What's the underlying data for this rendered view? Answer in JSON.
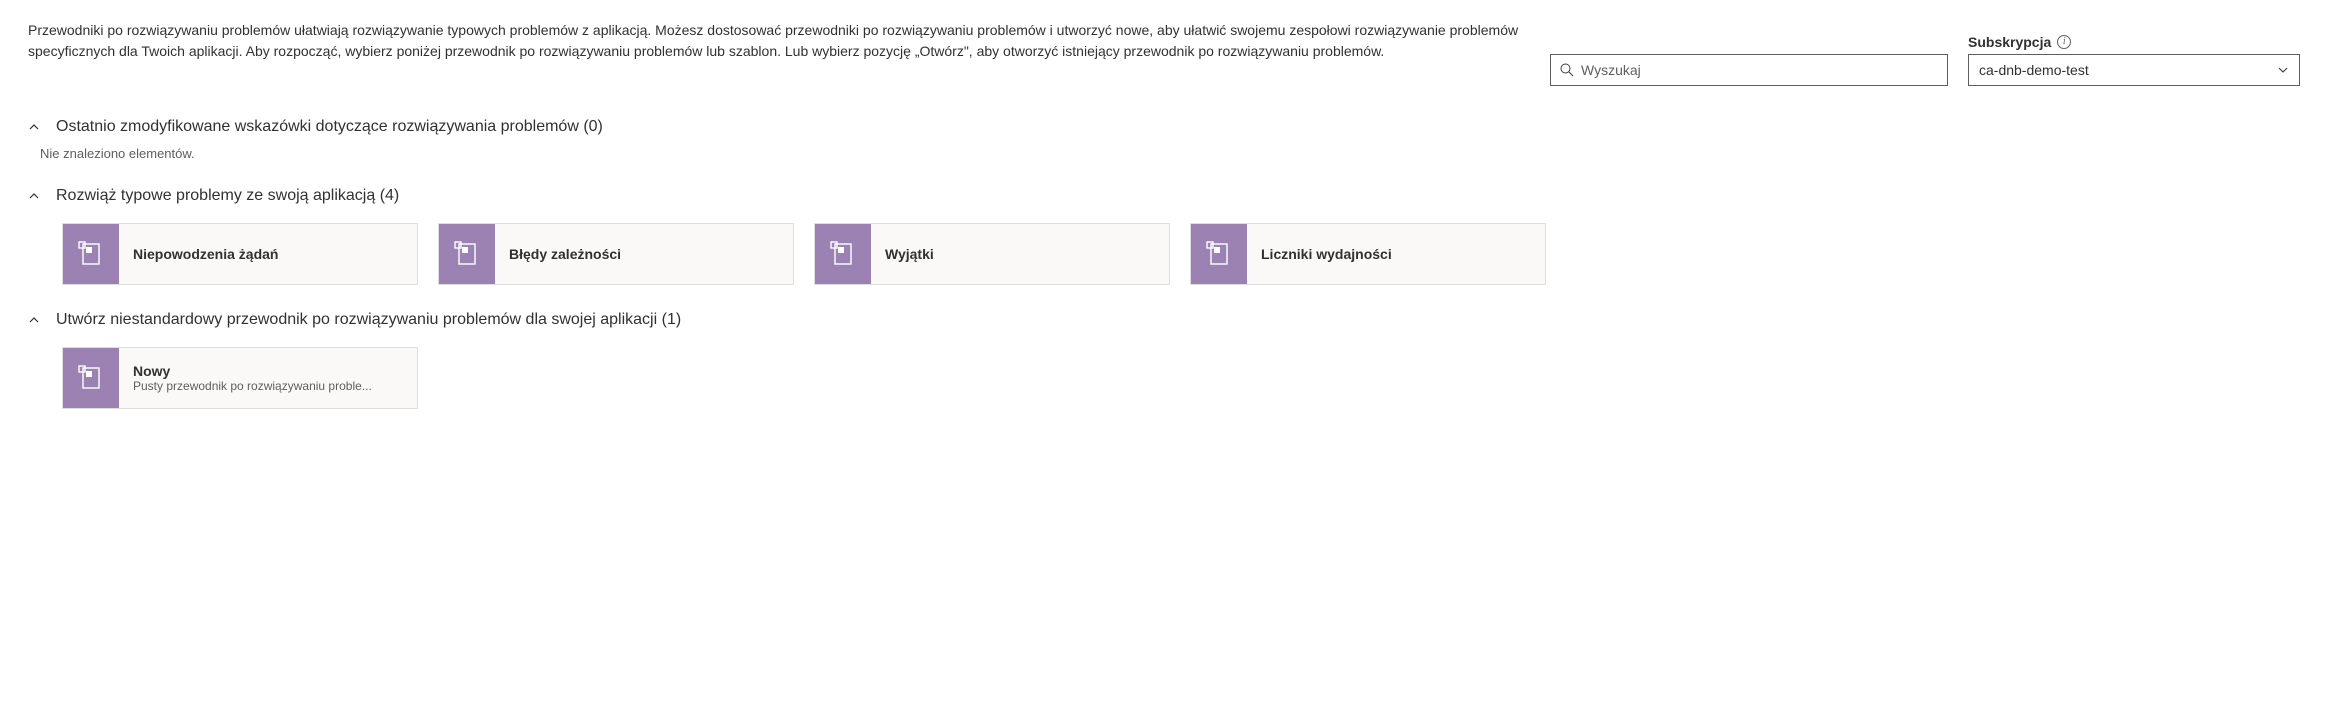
{
  "description": "Przewodniki po rozwiązywaniu problemów ułatwiają rozwiązywanie typowych problemów z aplikacją. Możesz dostosować przewodniki po rozwiązywaniu problemów i utworzyć nowe, aby ułatwić swojemu zespołowi rozwiązywanie problemów specyficznych dla Twoich aplikacji. Aby rozpocząć, wybierz poniżej przewodnik po rozwiązywaniu problemów lub szablon. Lub wybierz pozycję „Otwórz\", aby otworzyć istniejący przewodnik po rozwiązywaniu problemów.",
  "search": {
    "placeholder": "Wyszukaj"
  },
  "subscription": {
    "label": "Subskrypcja",
    "value": "ca-dnb-demo-test"
  },
  "sections": [
    {
      "title": "Ostatnio zmodyfikowane wskazówki dotyczące rozwiązywania problemów (0)",
      "empty_text": "Nie znaleziono elementów.",
      "cards": []
    },
    {
      "title": "Rozwiąż typowe problemy ze swoją aplikacją (4)",
      "cards": [
        {
          "title": "Niepowodzenia żądań"
        },
        {
          "title": "Błędy zależności"
        },
        {
          "title": "Wyjątki"
        },
        {
          "title": "Liczniki wydajności"
        }
      ]
    },
    {
      "title": "Utwórz niestandardowy przewodnik po rozwiązywaniu problemów dla swojej aplikacji (1)",
      "cards": [
        {
          "title": "Nowy",
          "subtitle": "Pusty przewodnik po rozwiązywaniu proble..."
        }
      ]
    }
  ]
}
